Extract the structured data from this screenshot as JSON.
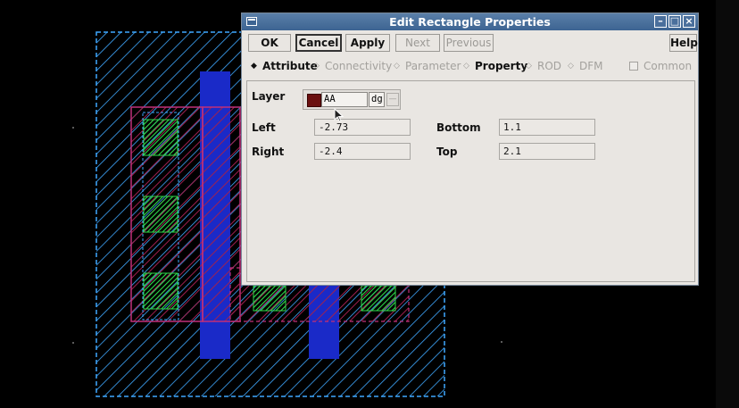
{
  "dialog": {
    "title": "Edit Rectangle Properties",
    "window_buttons": [
      "minimize",
      "maximize",
      "close"
    ]
  },
  "toolbar": {
    "ok_label": "OK",
    "cancel_label": "Cancel",
    "apply_label": "Apply",
    "next_label": "Next",
    "previous_label": "Previous",
    "help_label": "Help"
  },
  "tabs": {
    "attribute": "Attribute",
    "connectivity": "Connectivity",
    "parameter": "Parameter",
    "property": "Property",
    "rod": "ROD",
    "dfm": "DFM",
    "common": "Common"
  },
  "form": {
    "layer_label": "Layer",
    "layer_name": "AA",
    "layer_purpose": "dg",
    "layer_color": "#6b1010",
    "left_label": "Left",
    "left_value": "-2.73",
    "right_label": "Right",
    "right_value": "-2.4",
    "bottom_label": "Bottom",
    "bottom_value": "1.1",
    "top_label": "Top",
    "top_value": "2.1"
  },
  "colors": {
    "titlebar": "#3d6492",
    "layout_outline": "#3fa8ff",
    "metal": "#b02060",
    "contact": "#2ed84a",
    "via": "#1a2ac8"
  }
}
